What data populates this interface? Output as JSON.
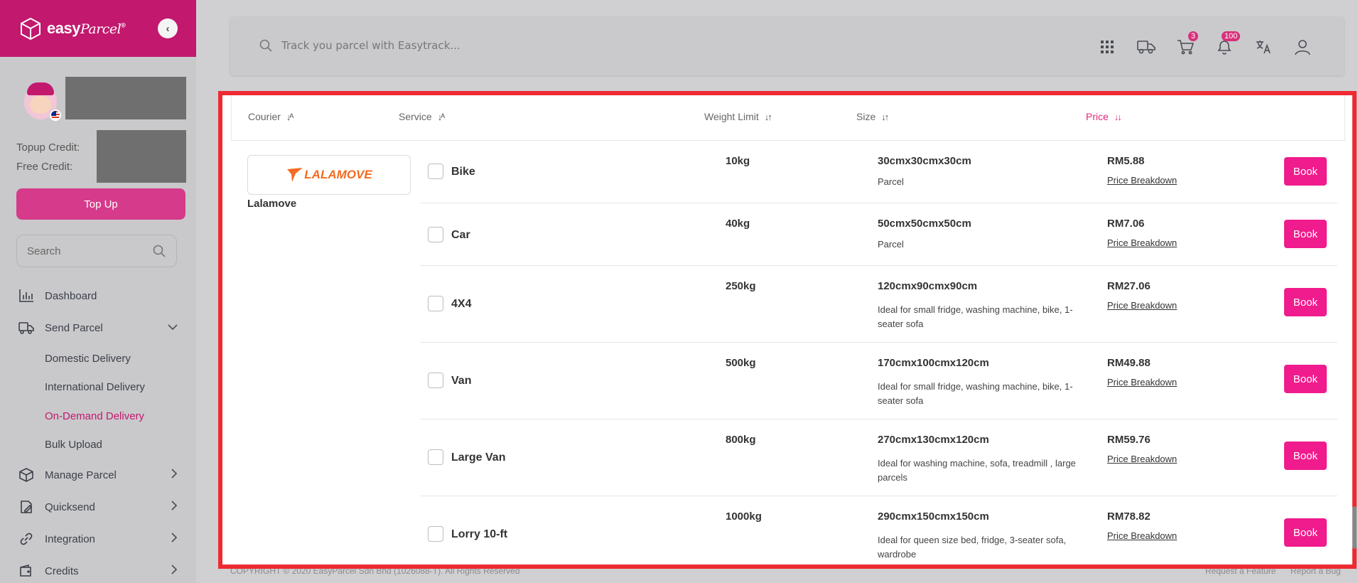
{
  "brand": {
    "name": "easy",
    "name_italic": "Parcel",
    "mark": "®"
  },
  "sidebar": {
    "topup_credit_label": "Topup Credit:",
    "free_credit_label": "Free Credit:",
    "topup_button": "Top Up",
    "search_placeholder": "Search",
    "nav": [
      {
        "label": "Dashboard",
        "icon": "bar-chart-icon"
      },
      {
        "label": "Send Parcel",
        "icon": "truck-icon"
      },
      {
        "label": "Manage Parcel",
        "icon": "box-icon"
      },
      {
        "label": "Quicksend",
        "icon": "edit-icon"
      },
      {
        "label": "Integration",
        "icon": "link-icon"
      },
      {
        "label": "Credits",
        "icon": "wallet-icon"
      }
    ],
    "send_parcel_sub": [
      {
        "label": "Domestic Delivery"
      },
      {
        "label": "International Delivery"
      },
      {
        "label": "On-Demand Delivery"
      },
      {
        "label": "Bulk Upload"
      }
    ]
  },
  "topbar": {
    "search_placeholder": "Track you parcel with Easytrack...",
    "cart_count": "3",
    "notification_count": "100"
  },
  "table": {
    "headers": {
      "courier": "Courier",
      "service": "Service",
      "weight": "Weight Limit",
      "size": "Size",
      "price": "Price"
    },
    "courier": {
      "name": "Lalamove",
      "logo_text": "LALAMOVE"
    },
    "price_breakdown_label": "Price Breakdown",
    "book_label": "Book",
    "rows": [
      {
        "service": "Bike",
        "weight": "10kg",
        "size": "30cmx30cmx30cm",
        "desc": "Parcel",
        "price": "RM5.88"
      },
      {
        "service": "Car",
        "weight": "40kg",
        "size": "50cmx50cmx50cm",
        "desc": "Parcel",
        "price": "RM7.06"
      },
      {
        "service": "4X4",
        "weight": "250kg",
        "size": "120cmx90cmx90cm",
        "desc": "Ideal for small fridge, washing machine, bike, 1-seater sofa",
        "price": "RM27.06"
      },
      {
        "service": "Van",
        "weight": "500kg",
        "size": "170cmx100cmx120cm",
        "desc": "Ideal for small fridge, washing machine, bike, 1-seater sofa",
        "price": "RM49.88"
      },
      {
        "service": "Large Van",
        "weight": "800kg",
        "size": "270cmx130cmx120cm",
        "desc": "Ideal for washing machine, sofa, treadmill , large parcels",
        "price": "RM59.76"
      },
      {
        "service": "Lorry 10-ft",
        "weight": "1000kg",
        "size": "290cmx150cmx150cm",
        "desc": "Ideal for queen size bed, fridge, 3-seater sofa, wardrobe",
        "price": "RM78.82"
      }
    ]
  },
  "footer": {
    "copyright": "COPYRIGHT © 2020 EasyParcel Sdn Bhd (1026088-T). All Rights Reserved",
    "request_feature": "Request a Feature",
    "report_bug": "Report a Bug"
  },
  "colors": {
    "brand": "#c2186e",
    "accent": "#f01b8c",
    "highlight": "#ee2a32"
  }
}
